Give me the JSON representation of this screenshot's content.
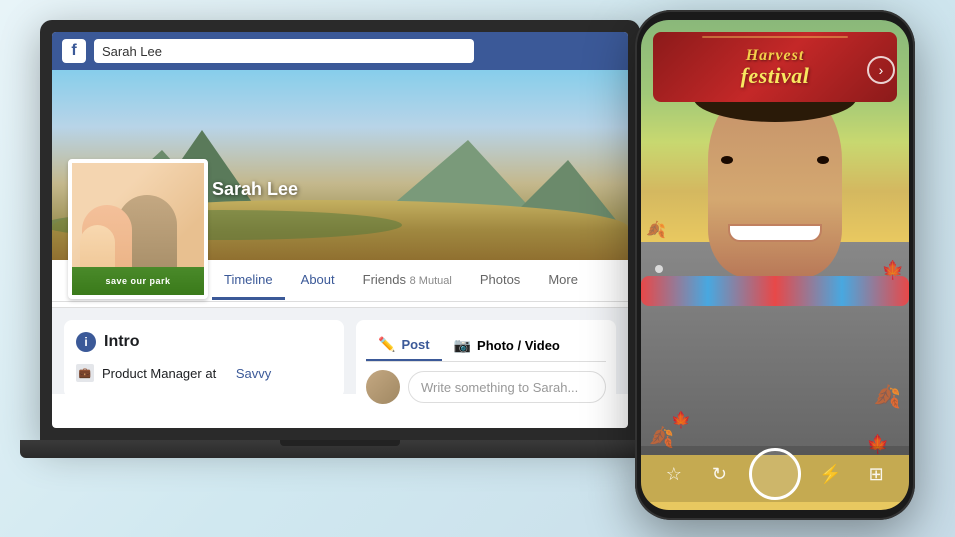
{
  "background": {
    "color1": "#e8f4f8",
    "color2": "#c8dce8"
  },
  "laptop": {
    "facebook": {
      "logo": "f",
      "search_value": "Sarah Lee",
      "profile_name": "Sarah Lee",
      "nav_items": [
        {
          "label": "Timeline",
          "active": true
        },
        {
          "label": "About",
          "active": false
        },
        {
          "label": "Friends",
          "active": false
        },
        {
          "label": "8 Mutual",
          "sub": true
        },
        {
          "label": "Photos",
          "active": false
        },
        {
          "label": "More",
          "active": false
        }
      ],
      "intro_title": "Intro",
      "intro_work": "Product Manager at",
      "intro_work_link": "Savvy",
      "save_park_label": "save our park",
      "composer_post_tab": "Post",
      "composer_photo_tab": "Photo / Video",
      "composer_placeholder": "Write something to Sarah..."
    }
  },
  "mobile": {
    "banner_top": "Harvest",
    "banner_bottom": "festival",
    "forward_icon": "›"
  },
  "leaves": [
    "🍂",
    "🍁",
    "🍂",
    "🍁",
    "🍂",
    "🍁"
  ],
  "icons": {
    "star": "☆",
    "refresh": "↻",
    "flash": "⚡",
    "gallery": "⊞"
  }
}
